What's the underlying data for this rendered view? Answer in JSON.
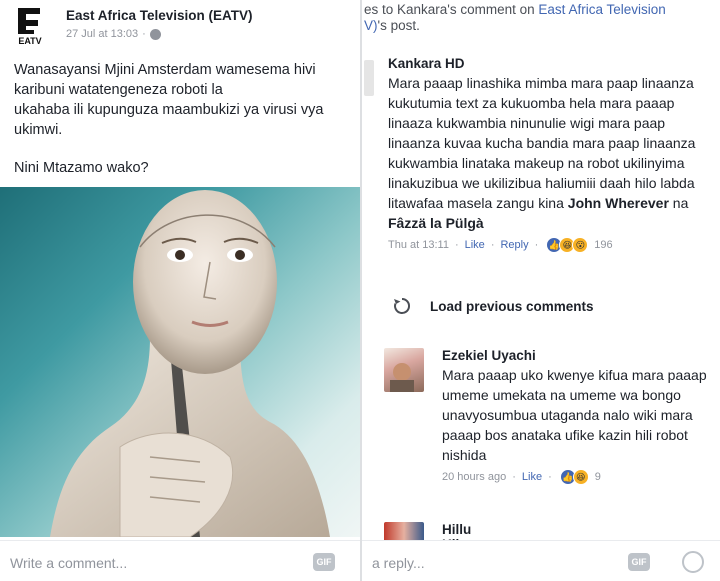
{
  "left": {
    "page_name": "East Africa Television (EATV)",
    "post_time": "27 Jul at 13:03",
    "separator": "·",
    "post_lines": [
      "Wanasayansi Mjini Amsterdam wamesema hivi",
      "karibuni watatengeneza roboti la",
      "ukahaba ili kupunguza maambukizi ya virusi vya",
      "ukimwi."
    ],
    "question": "Nini Mtazamo wako?",
    "composer_placeholder": "Write a comment...",
    "gif_label": "GIF",
    "logo_text": "EATV"
  },
  "right": {
    "reply_ref_prefix": "es to Kankara's comment on ",
    "reply_ref_link": "East Africa Television",
    "reply_ref_link2": "V)",
    "reply_ref_suffix": "'s post.",
    "main_comment": {
      "name": "Kankara HD",
      "text": "Mara paaap linashika mimba mara paap linaanza kukutumia text za kukuomba hela mara paaap linaaza kukwambia ninunulie wigi mara paap linaanza kuvaa kucha bandia mara paap linaanza kukwambia linataka makeup na robot ukilinyima linakuzibua we ukilizibua haliumiii daah hilo labda litawafaa masela zangu kina ",
      "mention1": "John Wherever",
      "mention_joiner": " na ",
      "mention2": "Fâzzä la Pülgà",
      "time": "Thu at 13:11",
      "like": "Like",
      "reply": "Reply",
      "reaction_count": "196"
    },
    "load_previous": "Load previous comments",
    "reply_comment": {
      "name": "Ezekiel Uyachi",
      "text": "Mara paaap uko kwenye kifua mara paaap umeme umekata na umeme wa bongo unavyosumbua utaganda nalo wiki mara paaap bos anataka ufike kazin hili robot nishida",
      "time": "20 hours ago",
      "like": "Like",
      "reaction_count": "9"
    },
    "partial_comment_name": "Hillu Kilengawana",
    "composer_placeholder": "a reply...",
    "gif_label": "GIF"
  },
  "colors": {
    "link": "#4267b2",
    "meta": "#90949c",
    "text": "#1d2129"
  }
}
